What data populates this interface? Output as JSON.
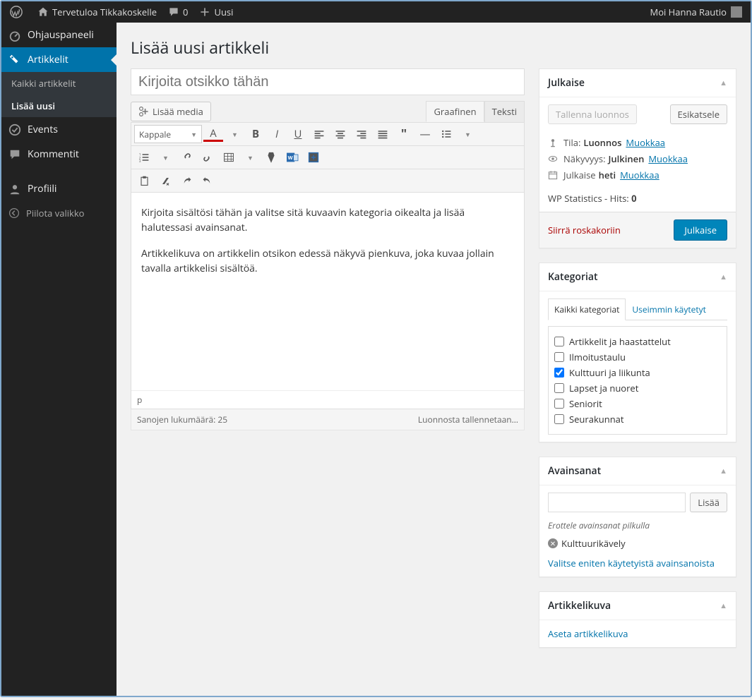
{
  "adminbar": {
    "site": "Tervetuloa Tikkakoskelle",
    "comments": "0",
    "new": "Uusi",
    "greeting": "Moi Hanna Rautio"
  },
  "menu": {
    "dashboard": "Ohjauspaneeli",
    "posts": "Artikkelit",
    "posts_sub": {
      "all": "Kaikki artikkelit",
      "add": "Lisää uusi"
    },
    "events": "Events",
    "comments": "Kommentit",
    "profile": "Profiili",
    "collapse": "Piilota valikko"
  },
  "page": {
    "title": "Lisää uusi artikkeli"
  },
  "editor": {
    "title_placeholder": "Kirjoita otsikko tähän",
    "add_media": "Lisää media",
    "tab_visual": "Graafinen",
    "tab_text": "Teksti",
    "format_select": "Kappale",
    "body_p1": "Kirjoita sisältösi tähän ja valitse sitä kuvaavin kategoria oikealta ja lisää halutessasi avainsanat.",
    "body_p2": "Artikkelikuva on artikkelin otsikon edessä näkyvä pienkuva, joka kuvaa jollain tavalla artikkelisi sisältöä.",
    "path": "p",
    "wordcount": "Sanojen lukumäärä: 25",
    "autosave": "Luonnosta tallennetaan…"
  },
  "publish": {
    "box_title": "Julkaise",
    "save_draft": "Tallenna luonnos",
    "preview": "Esikatsele",
    "status_label": "Tila:",
    "status_value": "Luonnos",
    "edit": "Muokkaa",
    "visibility_label": "Näkyvyys:",
    "visibility_value": "Julkinen",
    "publish_label": "Julkaise",
    "publish_value": "heti",
    "stats": "WP Statistics - Hits: ",
    "stats_val": "0",
    "trash": "Siirrä roskakoriin",
    "publish_btn": "Julkaise"
  },
  "categories": {
    "box_title": "Kategoriat",
    "tab_all": "Kaikki kategoriat",
    "tab_pop": "Useimmin käytetyt",
    "items": [
      {
        "label": "Artikkelit ja haastattelut",
        "checked": false
      },
      {
        "label": "Ilmoitustaulu",
        "checked": false
      },
      {
        "label": "Kulttuuri ja liikunta",
        "checked": true
      },
      {
        "label": "Lapset ja nuoret",
        "checked": false
      },
      {
        "label": "Seniorit",
        "checked": false
      },
      {
        "label": "Seurakunnat",
        "checked": false
      }
    ]
  },
  "tags": {
    "box_title": "Avainsanat",
    "add": "Lisää",
    "hint": "Erottele avainsanat pilkulla",
    "chip": "Kulttuurikävely",
    "popular": "Valitse eniten käytetyistä avainsanoista"
  },
  "featured": {
    "box_title": "Artikkelikuva",
    "set": "Aseta artikkelikuva"
  }
}
